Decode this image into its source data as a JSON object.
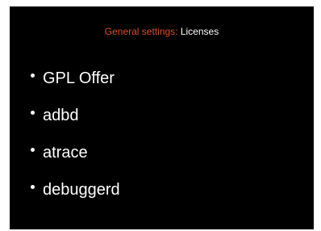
{
  "header": {
    "section": "General settings:",
    "page": "Licenses",
    "section_color": "#d9502b"
  },
  "licenses": [
    {
      "label": "GPL Offer"
    },
    {
      "label": "adbd"
    },
    {
      "label": "atrace"
    },
    {
      "label": "debuggerd"
    }
  ]
}
